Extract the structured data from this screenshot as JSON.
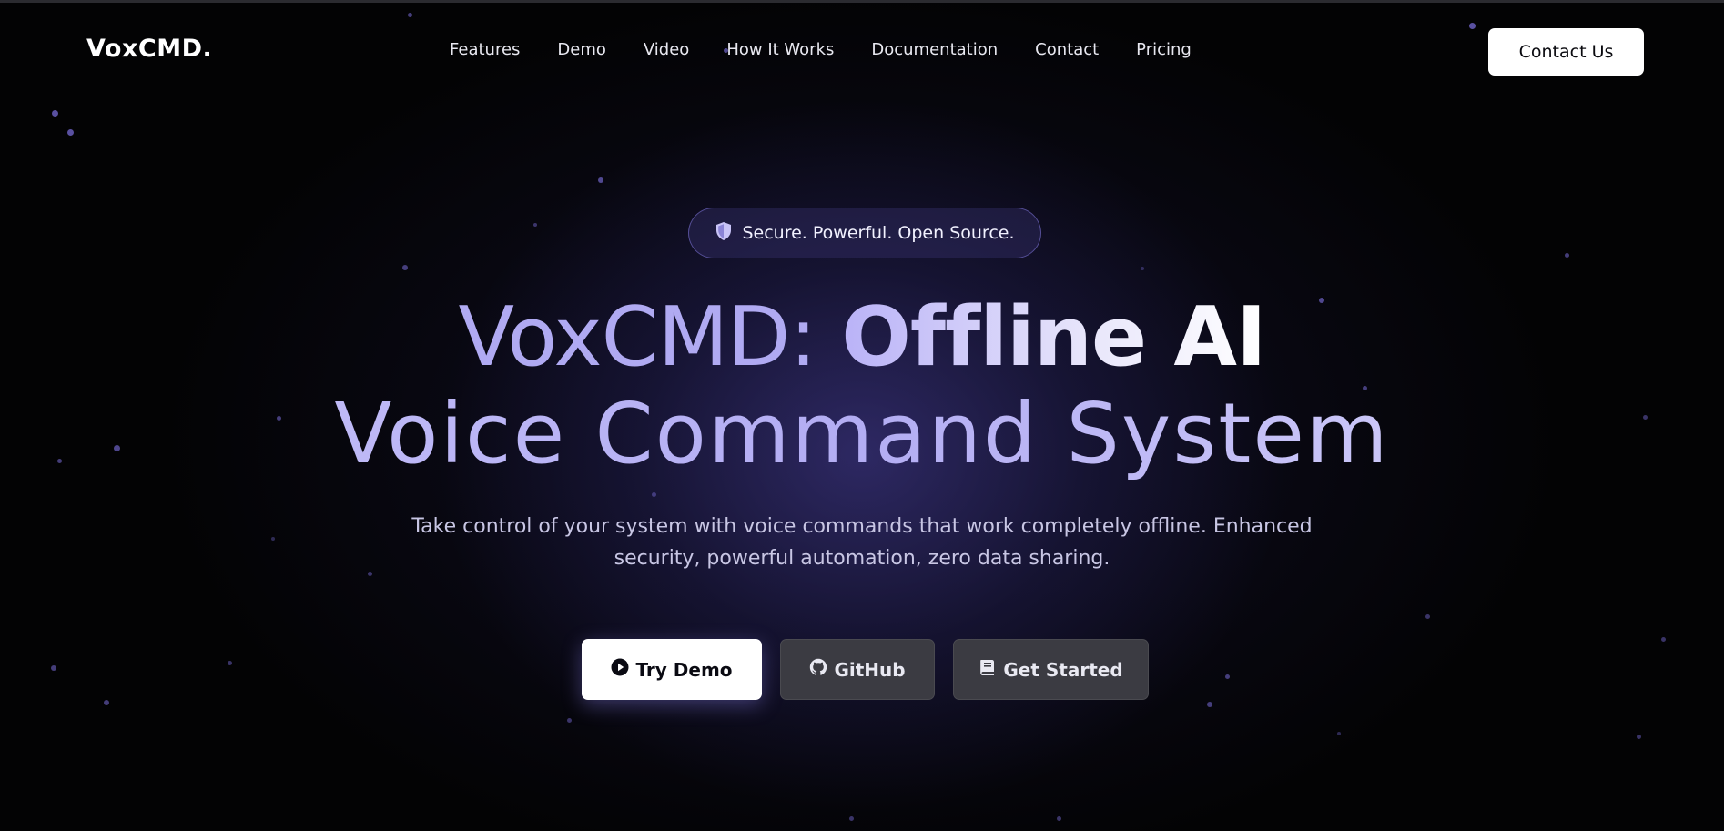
{
  "header": {
    "logo": "VoxCMD.",
    "nav": [
      "Features",
      "Demo",
      "Video",
      "How It Works",
      "Documentation",
      "Contact",
      "Pricing"
    ],
    "contact_button": "Contact Us"
  },
  "hero": {
    "badge_icon": "shield-icon",
    "badge_text": "Secure. Powerful. Open Source.",
    "title_line1_light": "VoxCMD: ",
    "title_line1_bold": "Offline AI",
    "title_line2": "Voice Command System",
    "subtitle": "Take control of your system with voice commands that work completely offline. Enhanced security, powerful automation, zero data sharing.",
    "buttons": {
      "try_demo": {
        "label": "Try Demo",
        "icon": "play-circle-icon"
      },
      "github": {
        "label": "GitHub",
        "icon": "github-icon"
      },
      "get_started": {
        "label": "Get Started",
        "icon": "book-icon"
      }
    }
  },
  "colors": {
    "background": "#030304",
    "accent": "#b4aef5",
    "button_dark": "#3b3b42"
  }
}
